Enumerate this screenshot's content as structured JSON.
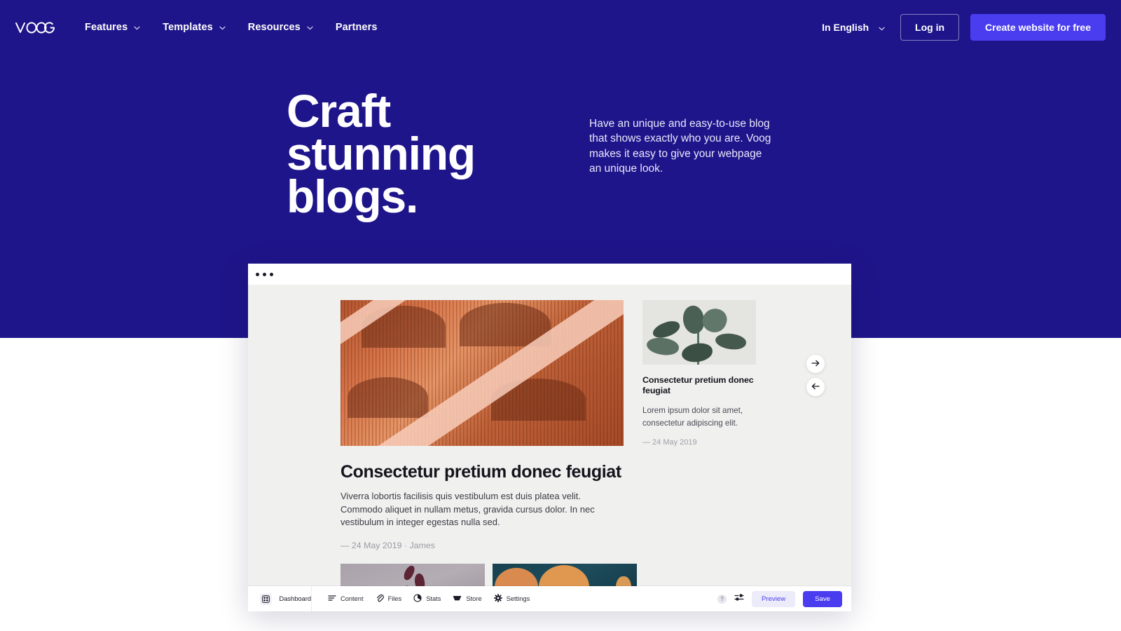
{
  "theme": {
    "hero_bg": "#1f158a",
    "accent": "#4a3df0",
    "preview_bg": "#ecebfa",
    "panel_bg": "#f0f0ef"
  },
  "navbar": {
    "brand": "VOOG",
    "links": [
      {
        "label": "Features",
        "has_caret": true
      },
      {
        "label": "Templates",
        "has_caret": true
      },
      {
        "label": "Resources",
        "has_caret": true
      },
      {
        "label": "Partners",
        "has_caret": false
      }
    ],
    "language": {
      "label": "In English",
      "has_caret": true
    },
    "login_label": "Log in",
    "create_label": "Create website for free"
  },
  "hero": {
    "title": "Craft stunning blogs.",
    "subtitle": "Have an unique and easy-to-use blog that shows exactly who you are. Voog makes it easy to give your webpage\nan unique look."
  },
  "browser": {
    "window_dots": 3,
    "blog": {
      "featured": {
        "image_alt": "terracotta-architecture-photo",
        "title": "Consectetur pretium donec feugiat",
        "excerpt": "Viverra lobortis facilisis quis vestibulum est duis platea velit. Commodo aliquet in nullam metus, gravida cursus dolor. In nec vestibulum in integer egestas nulla sed.",
        "meta": "— 24 May 2019 · James"
      },
      "sidebar_post": {
        "image_alt": "rubber-plant-photo",
        "title": "Consectetur pretium donec feugiat",
        "excerpt": "Lorem ipsum dolor sit amet, consectetur adipiscing elit.",
        "meta": "— 24 May 2019"
      },
      "thumbnails": [
        {
          "alt": "purple-leaves-photo"
        },
        {
          "alt": "wooden-bowls-photo"
        }
      ],
      "carousel": {
        "next_icon": "arrow-right-icon",
        "prev_icon": "arrow-left-icon"
      }
    },
    "admin_bar": {
      "dashboard_label": "Dashboard",
      "dashboard_icon": "grid-dashboard-icon",
      "tools": [
        {
          "label": "Content",
          "icon": "lines-content-icon"
        },
        {
          "label": "Files",
          "icon": "paperclip-files-icon"
        },
        {
          "label": "Stats",
          "icon": "pie-stats-icon"
        },
        {
          "label": "Store",
          "icon": "cart-store-icon"
        },
        {
          "label": "Settings",
          "icon": "gear-settings-icon"
        }
      ],
      "help_icon": "question-mark-icon",
      "toggle_icon": "sliders-toggle-icon",
      "preview_label": "Preview",
      "save_label": "Save"
    }
  }
}
